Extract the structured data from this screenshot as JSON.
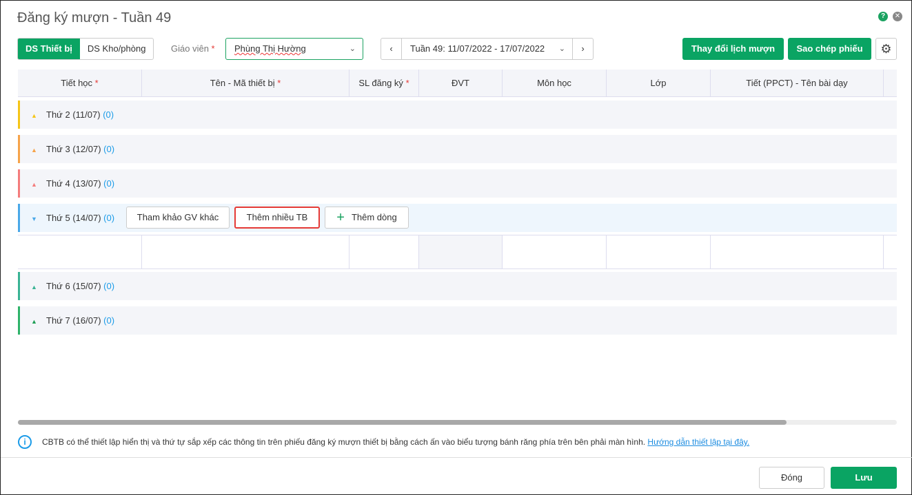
{
  "title": "Đăng ký mượn - Tuần 49",
  "tabs": [
    "DS Thiết bị",
    "DS Kho/phòng"
  ],
  "teacher": {
    "label": "Giáo viên",
    "required": "*",
    "value": "Phùng Thị Hường"
  },
  "week": {
    "value": "Tuần 49: 11/07/2022 - 17/07/2022",
    "prev": "‹",
    "next": "›"
  },
  "buttons": {
    "change": "Thay đổi lịch mượn",
    "copy": "Sao chép phiếu",
    "consult": "Tham khảo GV khác",
    "add_many": "Thêm nhiều TB",
    "add_row": "Thêm dòng",
    "close": "Đóng",
    "save": "Lưu"
  },
  "columns": [
    {
      "label": "Tiết học",
      "req": "*"
    },
    {
      "label": "Tên - Mã thiết bị",
      "req": "*"
    },
    {
      "label": "SL đăng ký",
      "req": "*"
    },
    {
      "label": "ĐVT",
      "req": ""
    },
    {
      "label": "Môn học",
      "req": ""
    },
    {
      "label": "Lớp",
      "req": ""
    },
    {
      "label": "Tiết (PPCT) - Tên bài dạy",
      "req": ""
    }
  ],
  "days": [
    {
      "label": "Thứ 2 (11/07)",
      "count": "(0)",
      "color": "#f5c518"
    },
    {
      "label": "Thứ 3 (12/07)",
      "count": "(0)",
      "color": "#f6a34a"
    },
    {
      "label": "Thứ 4 (13/07)",
      "count": "(0)",
      "color": "#f47c7c"
    },
    {
      "label": "Thứ 5 (14/07)",
      "count": "(0)",
      "color": "#4aa8e8"
    },
    {
      "label": "Thứ 6 (15/07)",
      "count": "(0)",
      "color": "#3ab394"
    },
    {
      "label": "Thứ 7 (16/07)",
      "count": "(0)",
      "color": "#2fb36a"
    }
  ],
  "info": {
    "text": "CBTB có thể thiết lập hiển thị và thứ tự sắp xếp các thông tin trên phiếu đăng ký mượn thiết bị bằng cách ấn vào biểu tượng bánh răng phía trên bên phải màn hình. ",
    "link": "Hướng dẫn thiết lập tại đây."
  }
}
